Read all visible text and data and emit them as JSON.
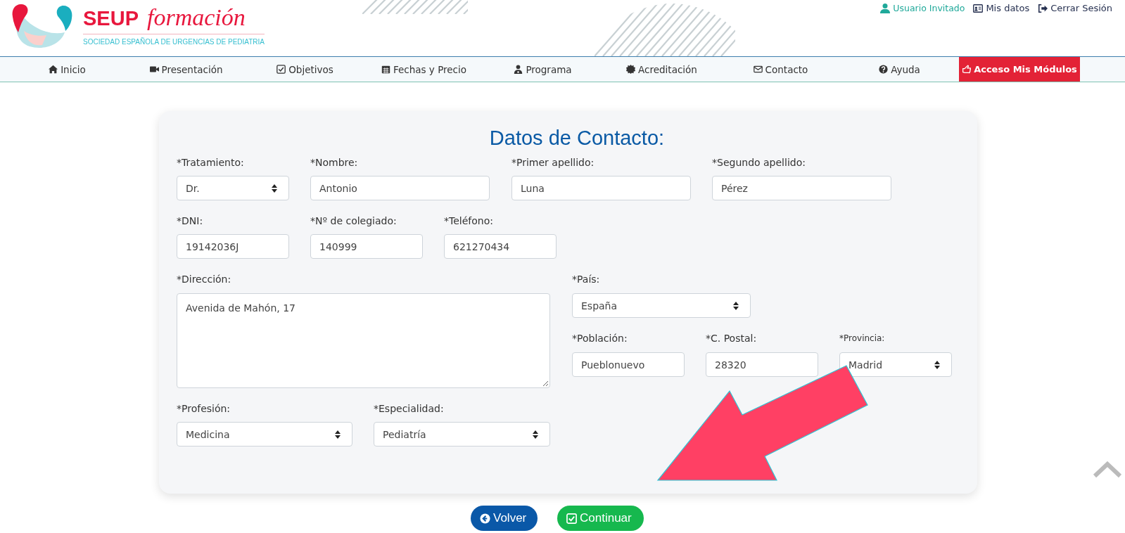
{
  "header": {
    "brand": "SEUP",
    "brand_script": "formación",
    "tagline": "SOCIEDAD ESPAÑOLA DE URGENCIAS DE PEDIATRIA",
    "user_links": [
      {
        "label": "Usuario Invitado",
        "kind": "user"
      },
      {
        "label": "Mis datos",
        "kind": "link"
      },
      {
        "label": "Cerrar Sesión",
        "kind": "link"
      }
    ]
  },
  "nav": [
    {
      "label": "Inicio",
      "kind": "link"
    },
    {
      "label": "Presentación",
      "kind": "link"
    },
    {
      "label": "Objetivos",
      "kind": "link"
    },
    {
      "label": "Fechas y Precio",
      "kind": "link"
    },
    {
      "label": "Programa",
      "kind": "link"
    },
    {
      "label": "Acreditación",
      "kind": "link"
    },
    {
      "label": "Contacto",
      "kind": "link"
    },
    {
      "label": "Ayuda",
      "kind": "link"
    },
    {
      "label": "Acceso Mis Módulos",
      "kind": "cta"
    }
  ],
  "form": {
    "title": "Datos de Contacto:",
    "rows": [
      {
        "fields": [
          {
            "label": "*Tratamiento:",
            "kind": "select",
            "value": "Dr."
          },
          {
            "label": "*Nombre:",
            "kind": "text",
            "value": "Antonio"
          },
          {
            "label": "*Primer apellido:",
            "kind": "text",
            "value": "Luna"
          },
          {
            "label": "*Segundo apellido:",
            "kind": "text",
            "value": "Pérez"
          }
        ]
      },
      {
        "fields": [
          {
            "label": "*DNI:",
            "kind": "text",
            "value": "19142036J"
          },
          {
            "label": "*Nº de colegiado:",
            "kind": "text",
            "value": "140999"
          },
          {
            "label": "*Teléfono:",
            "kind": "text",
            "value": "621270434"
          }
        ]
      },
      {
        "fields": [
          {
            "label": "*Dirección:",
            "kind": "textarea",
            "value": "Avenida de Mahón, 17"
          }
        ],
        "side_rows": [
          {
            "fields": [
              {
                "label": "*País:",
                "kind": "select",
                "value": "España"
              }
            ]
          },
          {
            "fields": [
              {
                "label": "*Población:",
                "kind": "text",
                "value": "Pueblonuevo"
              },
              {
                "label": "*C. Postal:",
                "kind": "text",
                "value": "28320"
              },
              {
                "label": "*Provincia:",
                "kind": "select",
                "value": "Madrid"
              }
            ]
          }
        ]
      },
      {
        "fields": [
          {
            "label": "*Profesión:",
            "kind": "select",
            "value": "Medicina"
          },
          {
            "label": "*Especialidad:",
            "kind": "select",
            "value": "Pediatría"
          }
        ]
      }
    ]
  },
  "actions": [
    {
      "label": "Volver",
      "kind": "back"
    },
    {
      "label": "Continuar",
      "kind": "next"
    }
  ]
}
